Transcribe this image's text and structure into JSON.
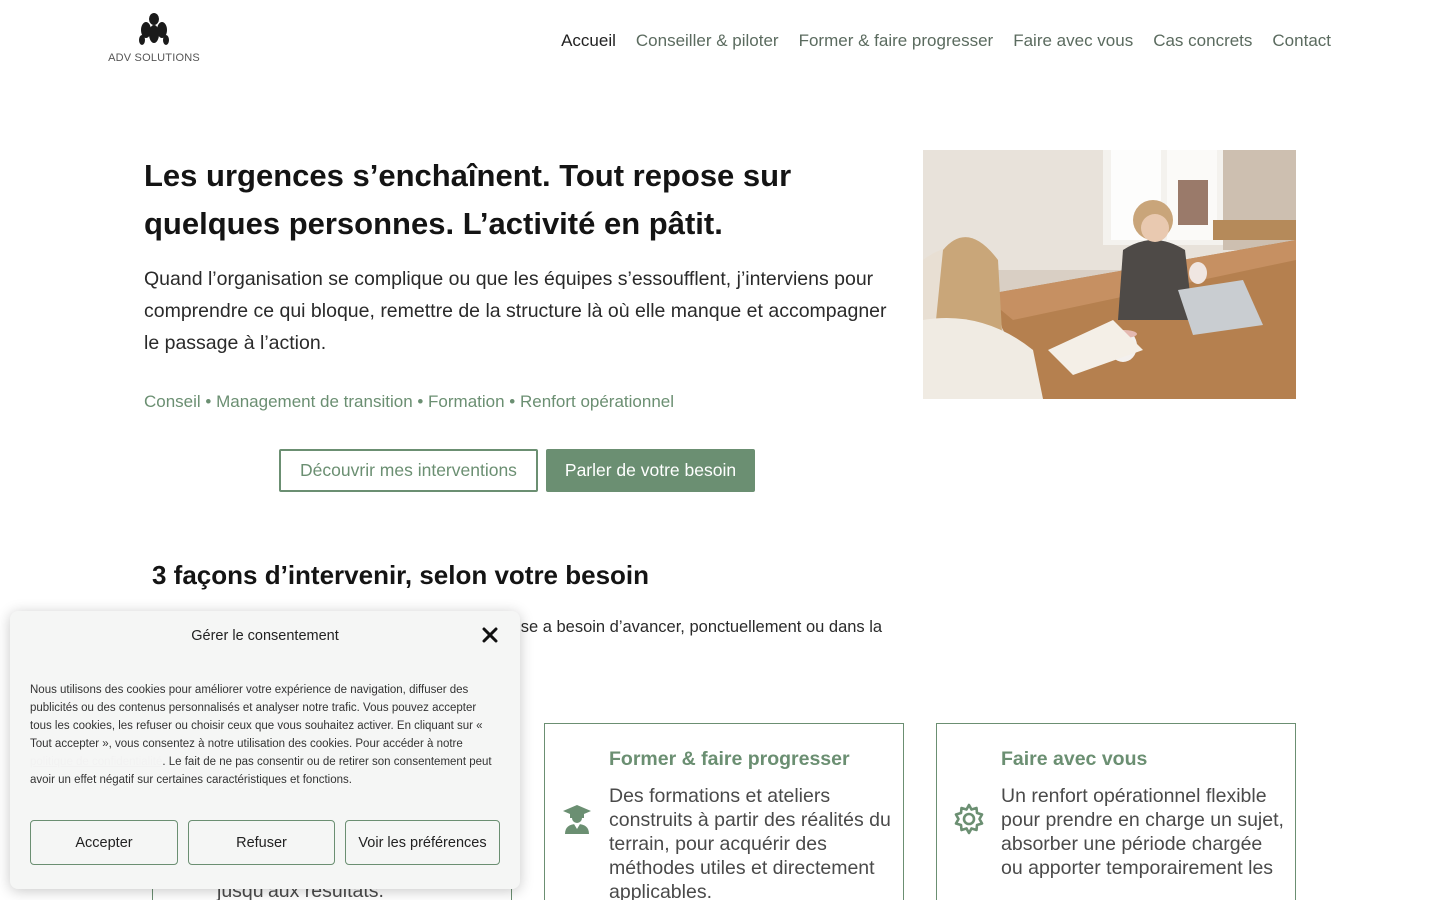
{
  "header": {
    "logo_text": "ADV SOLUTIONS",
    "nav": [
      {
        "label": "Accueil",
        "active": true
      },
      {
        "label": "Conseiller & piloter",
        "active": false
      },
      {
        "label": "Former & faire progresser",
        "active": false
      },
      {
        "label": "Faire avec vous",
        "active": false
      },
      {
        "label": "Cas concrets",
        "active": false
      },
      {
        "label": "Contact",
        "active": false
      }
    ]
  },
  "hero": {
    "title": "Les urgences s’enchaînent. Tout repose sur quelques personnes. L’activité en pâtit.",
    "text": "Quand l’organisation se complique ou que les équipes s’essoufflent, j’interviens pour comprendre ce qui bloque, remettre de la structure là où elle manque et accompagner le passage à l’action.",
    "tags": "Conseil • Management de transition • Formation • Renfort opérationnel",
    "cta_secondary": "Découvrir mes interventions",
    "cta_primary": "Parler de votre besoin"
  },
  "services": {
    "title": "3 façons d’intervenir, selon votre besoin",
    "intro": "renforcer l’opérationnel : j’interviens là où l’entreprise a besoin d’avancer, ponctuellement ou dans la",
    "cards": [
      {
        "title": "",
        "text": "jusqu’aux résultats.",
        "icon": "compass-icon"
      },
      {
        "title": "Former & faire progresser",
        "text": "Des formations et ateliers construits à partir des réalités du terrain, pour acquérir des méthodes utiles et directement applicables.",
        "icon": "graduate-icon"
      },
      {
        "title": "Faire avec vous",
        "text": "Un renfort opérationnel flexible pour prendre en charge un sujet, absorber une période chargée ou apporter temporairement les",
        "icon": "gear-icon"
      }
    ]
  },
  "consent": {
    "title": "Gérer le consentement",
    "text_before_link": "Nous utilisons des cookies pour améliorer votre expérience de navigation, diffuser des publicités ou des contenus personnalisés et analyser notre trafic. Vous pouvez accepter tous les cookies, les refuser ou choisir ceux que vous souhaitez activer. En cliquant sur « Tout accepter », vous consentez à notre utilisation des cookies. Pour accéder à notre",
    "link_text": "politique de confidentialité",
    "text_after_link": "Le fait de ne pas consentir ou de retirer son consentement peut avoir un effet négatif sur certaines caractéristiques et fonctions.",
    "accept_label": "Accepter",
    "refuse_label": "Refuser",
    "prefs_label": "Voir les préférences"
  },
  "colors": {
    "accent": "#6b8f72",
    "text": "#141414",
    "modal_bg": "#f5f6f5"
  }
}
